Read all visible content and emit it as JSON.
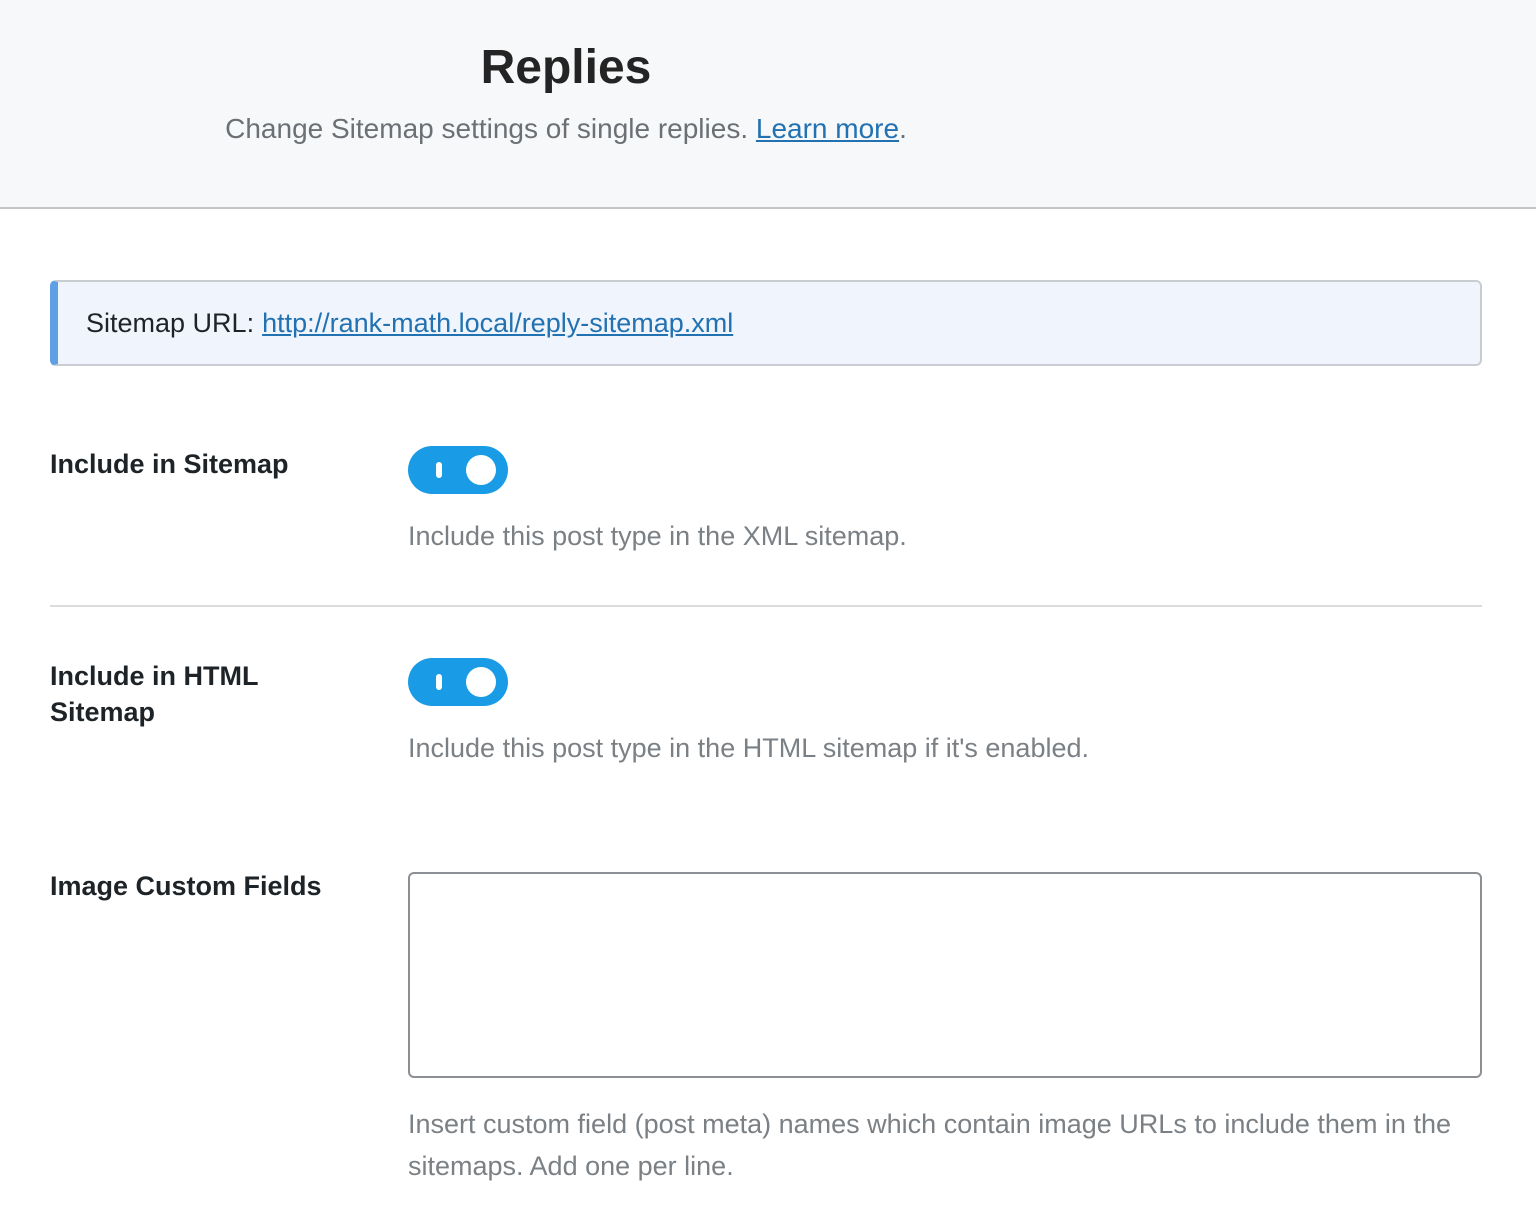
{
  "header": {
    "title": "Replies",
    "description": "Change Sitemap settings of single replies.",
    "learn_more_label": "Learn more",
    "description_suffix": "."
  },
  "notice": {
    "label": "Sitemap URL:",
    "url": "http://rank-math.local/reply-sitemap.xml"
  },
  "fields": {
    "include_sitemap": {
      "label": "Include in Sitemap",
      "enabled": true,
      "description": "Include this post type in the XML sitemap."
    },
    "include_html_sitemap": {
      "label": "Include in HTML Sitemap",
      "enabled": true,
      "description": "Include this post type in the HTML sitemap if it's enabled."
    },
    "image_custom_fields": {
      "label": "Image Custom Fields",
      "value": "",
      "description": "Insert custom field (post meta) names which contain image URLs to include them in the sitemaps. Add one per line."
    }
  },
  "colors": {
    "accent": "#1a9be6",
    "link": "#2271b1",
    "notice_border": "#5f9fe6"
  }
}
